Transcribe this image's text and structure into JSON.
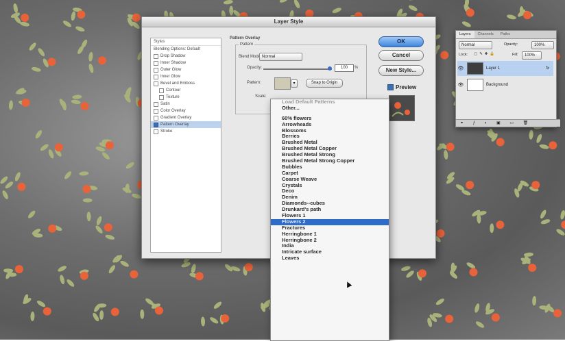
{
  "dialog": {
    "title": "Layer Style",
    "styles_header": "Styles",
    "style_items": [
      {
        "label": "Blending Options: Default",
        "checked": false,
        "sub": false,
        "selected": false,
        "checkbox": false
      },
      {
        "label": "Drop Shadow",
        "checked": false,
        "sub": false,
        "selected": false,
        "checkbox": true
      },
      {
        "label": "Inner Shadow",
        "checked": false,
        "sub": false,
        "selected": false,
        "checkbox": true
      },
      {
        "label": "Outer Glow",
        "checked": false,
        "sub": false,
        "selected": false,
        "checkbox": true
      },
      {
        "label": "Inner Glow",
        "checked": false,
        "sub": false,
        "selected": false,
        "checkbox": true
      },
      {
        "label": "Bevel and Emboss",
        "checked": false,
        "sub": false,
        "selected": false,
        "checkbox": true
      },
      {
        "label": "Contour",
        "checked": false,
        "sub": true,
        "selected": false,
        "checkbox": true
      },
      {
        "label": "Texture",
        "checked": false,
        "sub": true,
        "selected": false,
        "checkbox": true
      },
      {
        "label": "Satin",
        "checked": false,
        "sub": false,
        "selected": false,
        "checkbox": true
      },
      {
        "label": "Color Overlay",
        "checked": false,
        "sub": false,
        "selected": false,
        "checkbox": true
      },
      {
        "label": "Gradient Overlay",
        "checked": false,
        "sub": false,
        "selected": false,
        "checkbox": true
      },
      {
        "label": "Pattern Overlay",
        "checked": true,
        "sub": false,
        "selected": true,
        "checkbox": true
      },
      {
        "label": "Stroke",
        "checked": false,
        "sub": false,
        "selected": false,
        "checkbox": true
      }
    ],
    "section_title": "Pattern Overlay",
    "group_title": "Pattern",
    "blend_mode_label": "Blend Mode:",
    "blend_mode_value": "Normal",
    "opacity_label": "Opacity:",
    "opacity_value": "100",
    "opacity_unit": "%",
    "pattern_label": "Pattern:",
    "snap_button": "Snap to Origin",
    "scale_label": "Scale:",
    "ok": "OK",
    "cancel": "Cancel",
    "new_style": "New Style...",
    "preview": "Preview"
  },
  "dropdown": {
    "top_items": [
      "Load Default Patterns",
      "Other..."
    ],
    "items": [
      "60% flowers",
      "Arrowheads",
      "Blossoms",
      "Berries",
      "Brushed Metal",
      "Brushed Metal Copper",
      "Brushed Metal Strong",
      "Brushed Metal Strong Copper",
      "Bubbles",
      "Carpet",
      "Coarse Weave",
      "Crystals",
      "Deco",
      "Denim",
      "Diamonds--cubes",
      "Drunkard's path",
      "Flowers 1",
      "Flowers 2",
      "Fractures",
      "Herringbone 1",
      "Herringbone 2",
      "India",
      "Intricate surface",
      "Leaves"
    ],
    "highlighted": "Flowers 2",
    "highlight_color": "#2f6bc9"
  },
  "layers_panel": {
    "tabs": [
      "Layers",
      "Channels",
      "Paths"
    ],
    "blend_mode": "Normal",
    "opacity_label": "Opacity:",
    "opacity_value": "100%",
    "lock_label": "Lock:",
    "fill_label": "Fill:",
    "fill_value": "100%",
    "layers": [
      {
        "name": "Layer 1",
        "fx": "fx",
        "selected": true,
        "dark": true
      },
      {
        "name": "Background",
        "fx": "",
        "selected": false,
        "dark": false
      }
    ]
  }
}
